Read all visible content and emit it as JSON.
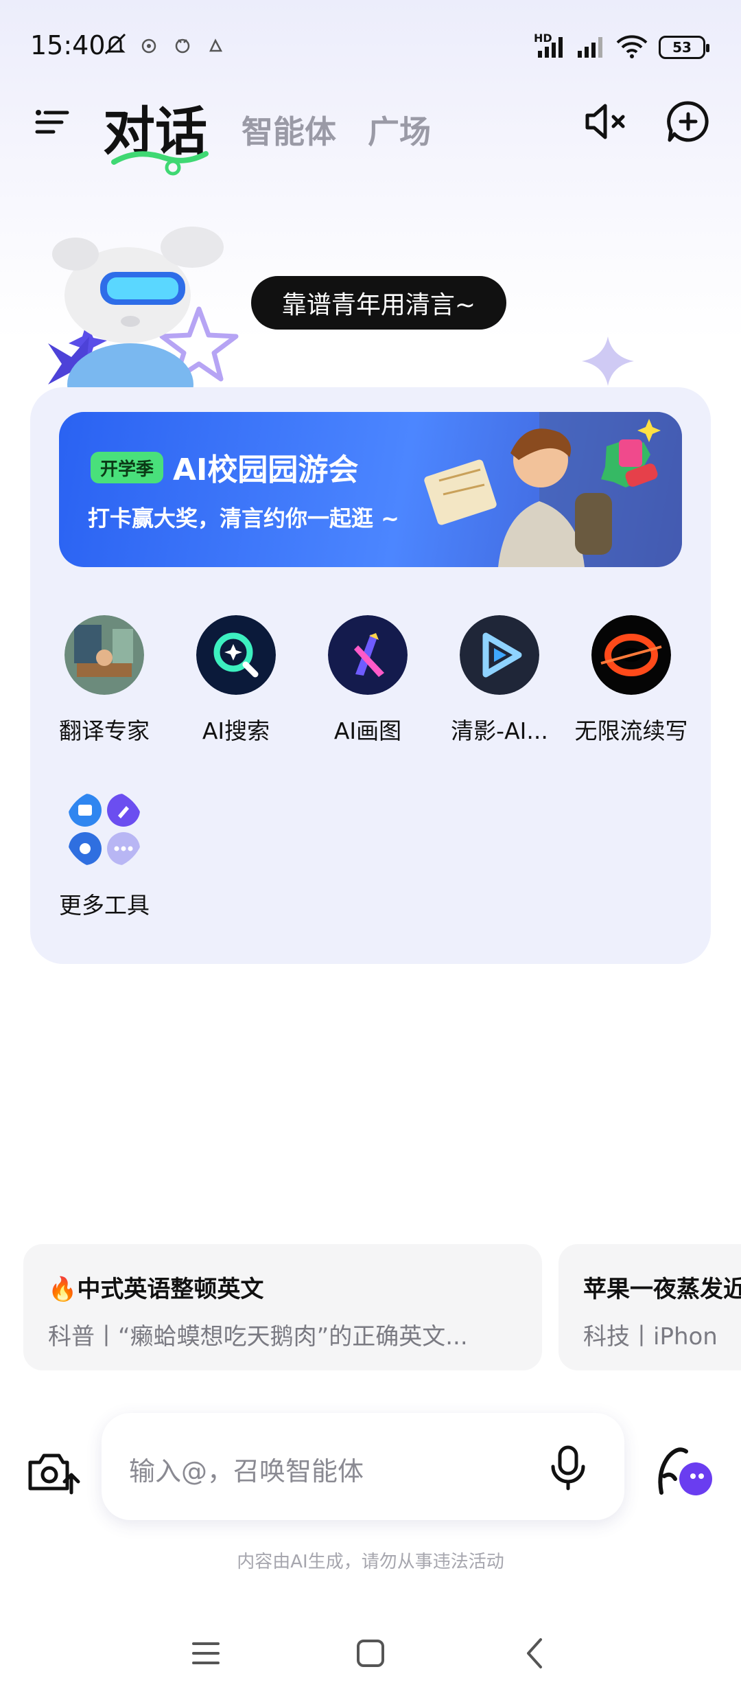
{
  "status_bar": {
    "time": "15:40",
    "battery": "53",
    "network_label": "HD"
  },
  "header": {
    "tabs": [
      {
        "label": "对话",
        "active": true
      },
      {
        "label": "智能体",
        "active": false
      },
      {
        "label": "广场",
        "active": false
      }
    ]
  },
  "hero": {
    "bubble_text": "靠谱青年用清言~"
  },
  "banner": {
    "badge": "开学季",
    "title": "AI校园园游会",
    "subtitle": "打卡赢大奖，清言约你一起逛 ~"
  },
  "tools": [
    {
      "label": "翻译专家",
      "icon": "translate-expert-icon"
    },
    {
      "label": "AI搜索",
      "icon": "ai-search-icon"
    },
    {
      "label": "AI画图",
      "icon": "ai-draw-icon"
    },
    {
      "label": "清影-AI...",
      "icon": "qingying-video-icon"
    },
    {
      "label": "无限流续写",
      "icon": "infinite-writing-icon"
    },
    {
      "label": "更多工具",
      "icon": "more-tools-icon"
    }
  ],
  "suggestions": [
    {
      "title": "中式英语整顿英文",
      "subtitle": "科普丨“癞蛤蟆想吃天鹅肉”的正确英文...",
      "hot": true
    },
    {
      "title": "苹果一夜蒸发近",
      "subtitle": "科技丨iPhone",
      "hot": false
    }
  ],
  "input": {
    "placeholder": "输入@，召唤智能体"
  },
  "disclaimer": "内容由AI生成，请勿从事违法活动",
  "colors": {
    "accent_green": "#49e07b",
    "banner_blue": "#3a70f5",
    "card_bg": "#eef0fc"
  }
}
